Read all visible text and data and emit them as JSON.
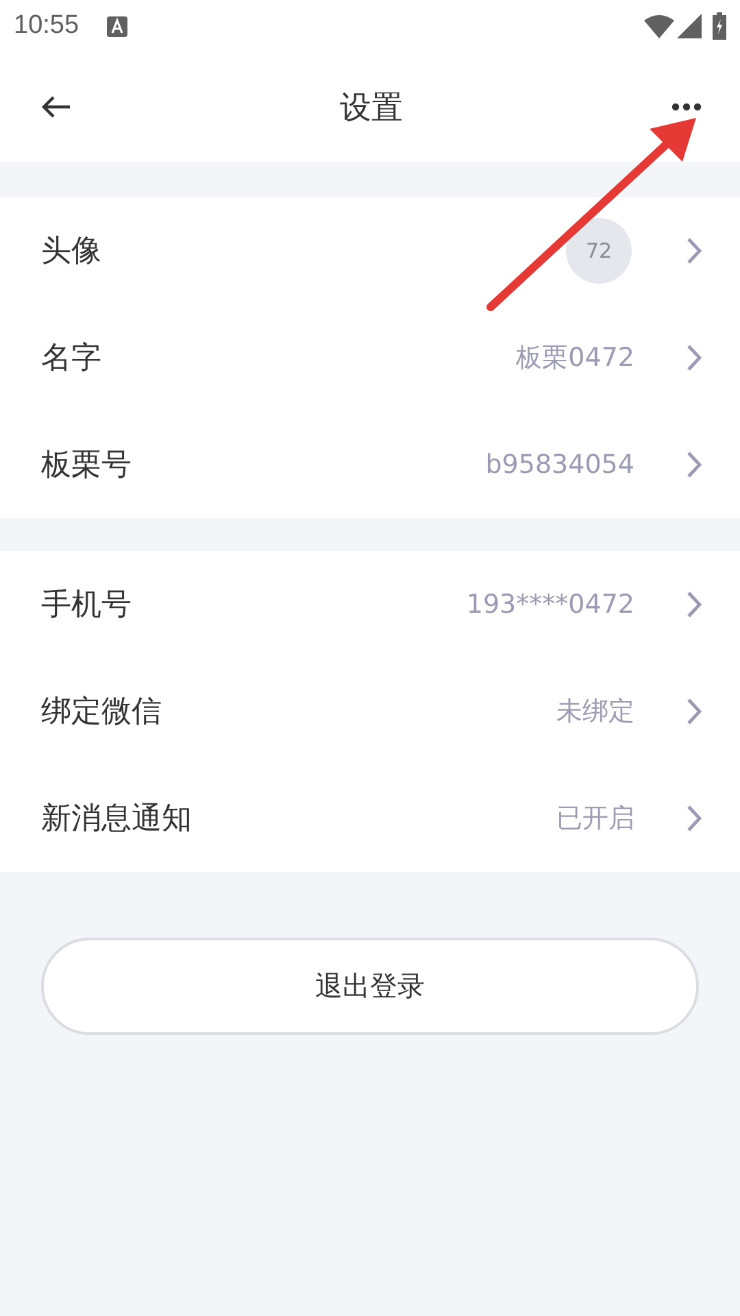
{
  "status_bar": {
    "time": "10:55"
  },
  "header": {
    "title": "设置"
  },
  "groups": [
    {
      "rows": [
        {
          "kind": "avatar",
          "label": "头像",
          "value": "72"
        },
        {
          "kind": "text",
          "label": "名字",
          "value": "板栗0472"
        },
        {
          "kind": "text",
          "label": "板栗号",
          "value": "b95834054"
        }
      ]
    },
    {
      "rows": [
        {
          "kind": "text",
          "label": "手机号",
          "value": "193****0472"
        },
        {
          "kind": "text",
          "label": "绑定微信",
          "value": "未绑定"
        },
        {
          "kind": "text",
          "label": "新消息通知",
          "value": "已开启"
        }
      ]
    }
  ],
  "logout_button": {
    "label": "退出登录"
  }
}
